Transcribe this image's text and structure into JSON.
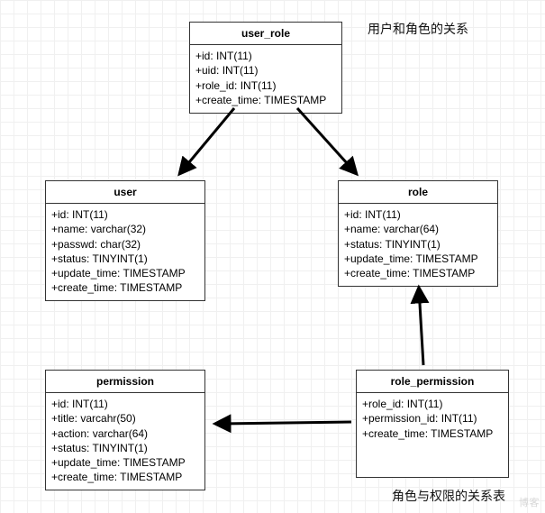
{
  "labels": {
    "top_right": "用户和角色的关系",
    "bottom_right": "角色与权限的关系表"
  },
  "entities": {
    "user_role": {
      "title": "user_role",
      "fields": [
        "+id: INT(11)",
        "+uid: INT(11)",
        "+role_id: INT(11)",
        "+create_time: TIMESTAMP"
      ]
    },
    "user": {
      "title": "user",
      "fields": [
        "+id: INT(11)",
        "+name: varchar(32)",
        "+passwd: char(32)",
        "+status: TINYINT(1)",
        "+update_time: TIMESTAMP",
        "+create_time: TIMESTAMP"
      ]
    },
    "role": {
      "title": "role",
      "fields": [
        "+id: INT(11)",
        "+name: varchar(64)",
        "+status: TINYINT(1)",
        "+update_time: TIMESTAMP",
        "+create_time: TIMESTAMP"
      ]
    },
    "permission": {
      "title": "permission",
      "fields": [
        "+id: INT(11)",
        "+title: varcahr(50)",
        "+action: varchar(64)",
        "+status: TINYINT(1)",
        "+update_time: TIMESTAMP",
        "+create_time: TIMESTAMP"
      ]
    },
    "role_permission": {
      "title": "role_permission",
      "fields": [
        "+role_id: INT(11)",
        "+permission_id: INT(11)",
        "+create_time: TIMESTAMP"
      ]
    }
  },
  "watermark": "博客"
}
